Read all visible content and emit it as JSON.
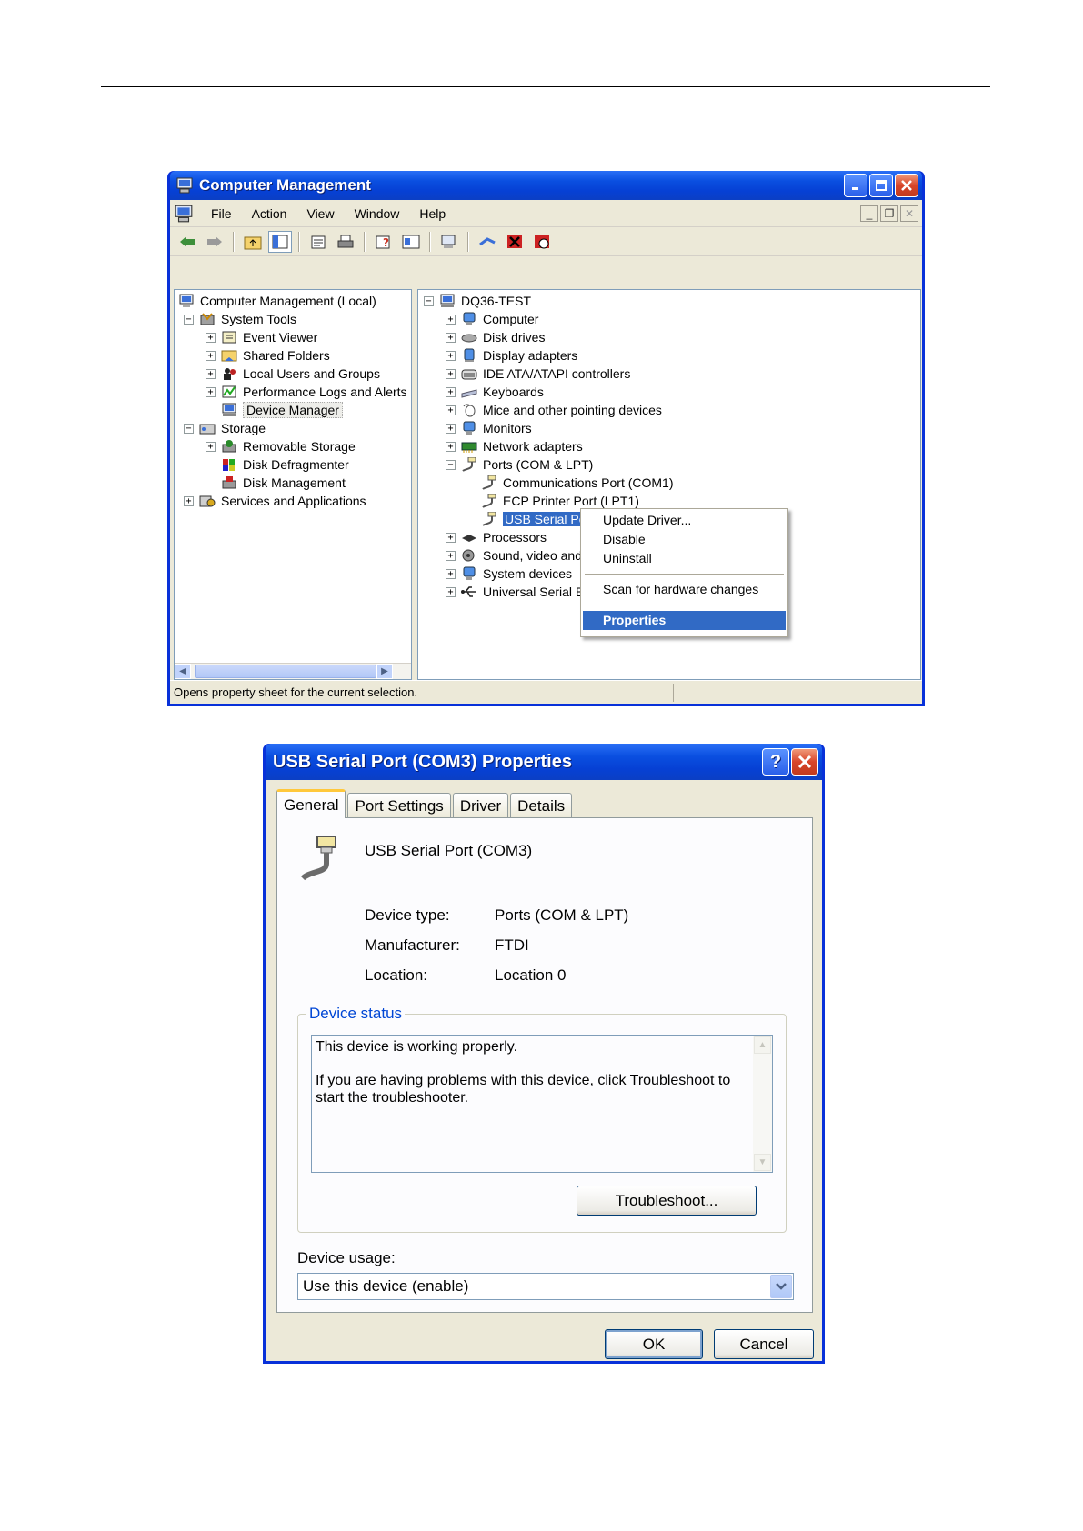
{
  "cm": {
    "title": "Computer Management",
    "menu": [
      "File",
      "Action",
      "View",
      "Window",
      "Help"
    ],
    "left_tree": [
      {
        "label": "Computer Management (Local)",
        "icon": "computer-icon"
      },
      {
        "label": "System Tools",
        "icon": "tools-icon"
      },
      {
        "label": "Event Viewer",
        "icon": "event-viewer-icon"
      },
      {
        "label": "Shared Folders",
        "icon": "shared-folder-icon"
      },
      {
        "label": "Local Users and Groups",
        "icon": "users-icon"
      },
      {
        "label": "Performance Logs and Alerts",
        "icon": "performance-icon"
      },
      {
        "label": "Device Manager",
        "icon": "device-manager-icon"
      },
      {
        "label": "Storage",
        "icon": "storage-icon"
      },
      {
        "label": "Removable Storage",
        "icon": "removable-storage-icon"
      },
      {
        "label": "Disk Defragmenter",
        "icon": "defragmenter-icon"
      },
      {
        "label": "Disk Management",
        "icon": "disk-management-icon"
      },
      {
        "label": "Services and Applications",
        "icon": "services-icon"
      }
    ],
    "right_tree": [
      {
        "label": "DQ36-TEST",
        "icon": "computer-icon"
      },
      {
        "label": "Computer",
        "icon": "monitor-icon"
      },
      {
        "label": "Disk drives",
        "icon": "disk-icon"
      },
      {
        "label": "Display adapters",
        "icon": "display-adapter-icon"
      },
      {
        "label": "IDE ATA/ATAPI controllers",
        "icon": "ide-icon"
      },
      {
        "label": "Keyboards",
        "icon": "keyboard-icon"
      },
      {
        "label": "Mice and other pointing devices",
        "icon": "mouse-icon"
      },
      {
        "label": "Monitors",
        "icon": "monitor-icon"
      },
      {
        "label": "Network adapters",
        "icon": "network-icon"
      },
      {
        "label": "Ports (COM & LPT)",
        "icon": "port-icon"
      },
      {
        "label": "Communications Port (COM1)",
        "icon": "port-icon"
      },
      {
        "label": "ECP Printer Port (LPT1)",
        "icon": "port-icon"
      },
      {
        "label": "USB Serial Port (COM3)",
        "icon": "port-icon"
      },
      {
        "label": "Processors",
        "icon": "processor-icon"
      },
      {
        "label": "Sound, video and game controllers",
        "icon": "sound-icon"
      },
      {
        "label": "System devices",
        "icon": "system-icon"
      },
      {
        "label": "Universal Serial Bus controllers",
        "icon": "usb-icon"
      }
    ],
    "context_menu": [
      "Update Driver...",
      "Disable",
      "Uninstall",
      "Scan for hardware changes",
      "Properties"
    ],
    "status": "Opens property sheet for the current selection."
  },
  "dlg": {
    "title": "USB Serial Port (COM3) Properties",
    "tabs": [
      "General",
      "Port Settings",
      "Driver",
      "Details"
    ],
    "device_name": "USB Serial Port (COM3)",
    "device_type_label": "Device type:",
    "device_type": "Ports (COM & LPT)",
    "manufacturer_label": "Manufacturer:",
    "manufacturer": "FTDI",
    "location_label": "Location:",
    "location": "Location 0",
    "status_group": "Device status",
    "status_line1": "This device is working properly.",
    "status_line2": "If you are having problems with this device, click Troubleshoot to start the troubleshooter.",
    "troubleshoot": "Troubleshoot...",
    "usage_label": "Device usage:",
    "usage_value": "Use this device (enable)",
    "ok": "OK",
    "cancel": "Cancel"
  }
}
